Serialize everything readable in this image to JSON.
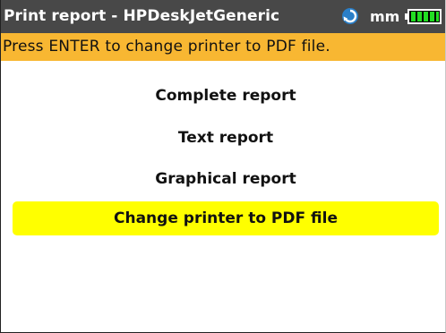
{
  "header": {
    "title": "Print report - HPDeskJetGeneric",
    "unit": "mm",
    "busy_icon": "circular-arrow-icon",
    "battery_icon": "battery-full-icon"
  },
  "status": {
    "message": "Press ENTER to change printer to PDF file."
  },
  "menu": {
    "items": [
      {
        "label": "Complete report"
      },
      {
        "label": "Text report"
      },
      {
        "label": "Graphical report"
      },
      {
        "label": "Change printer to PDF file",
        "selected": true
      }
    ]
  },
  "colors": {
    "titlebar_bg": "#484848",
    "statusbar_bg": "#f8b732",
    "selection_bg": "#ffff00",
    "battery_green": "#22dd22"
  }
}
